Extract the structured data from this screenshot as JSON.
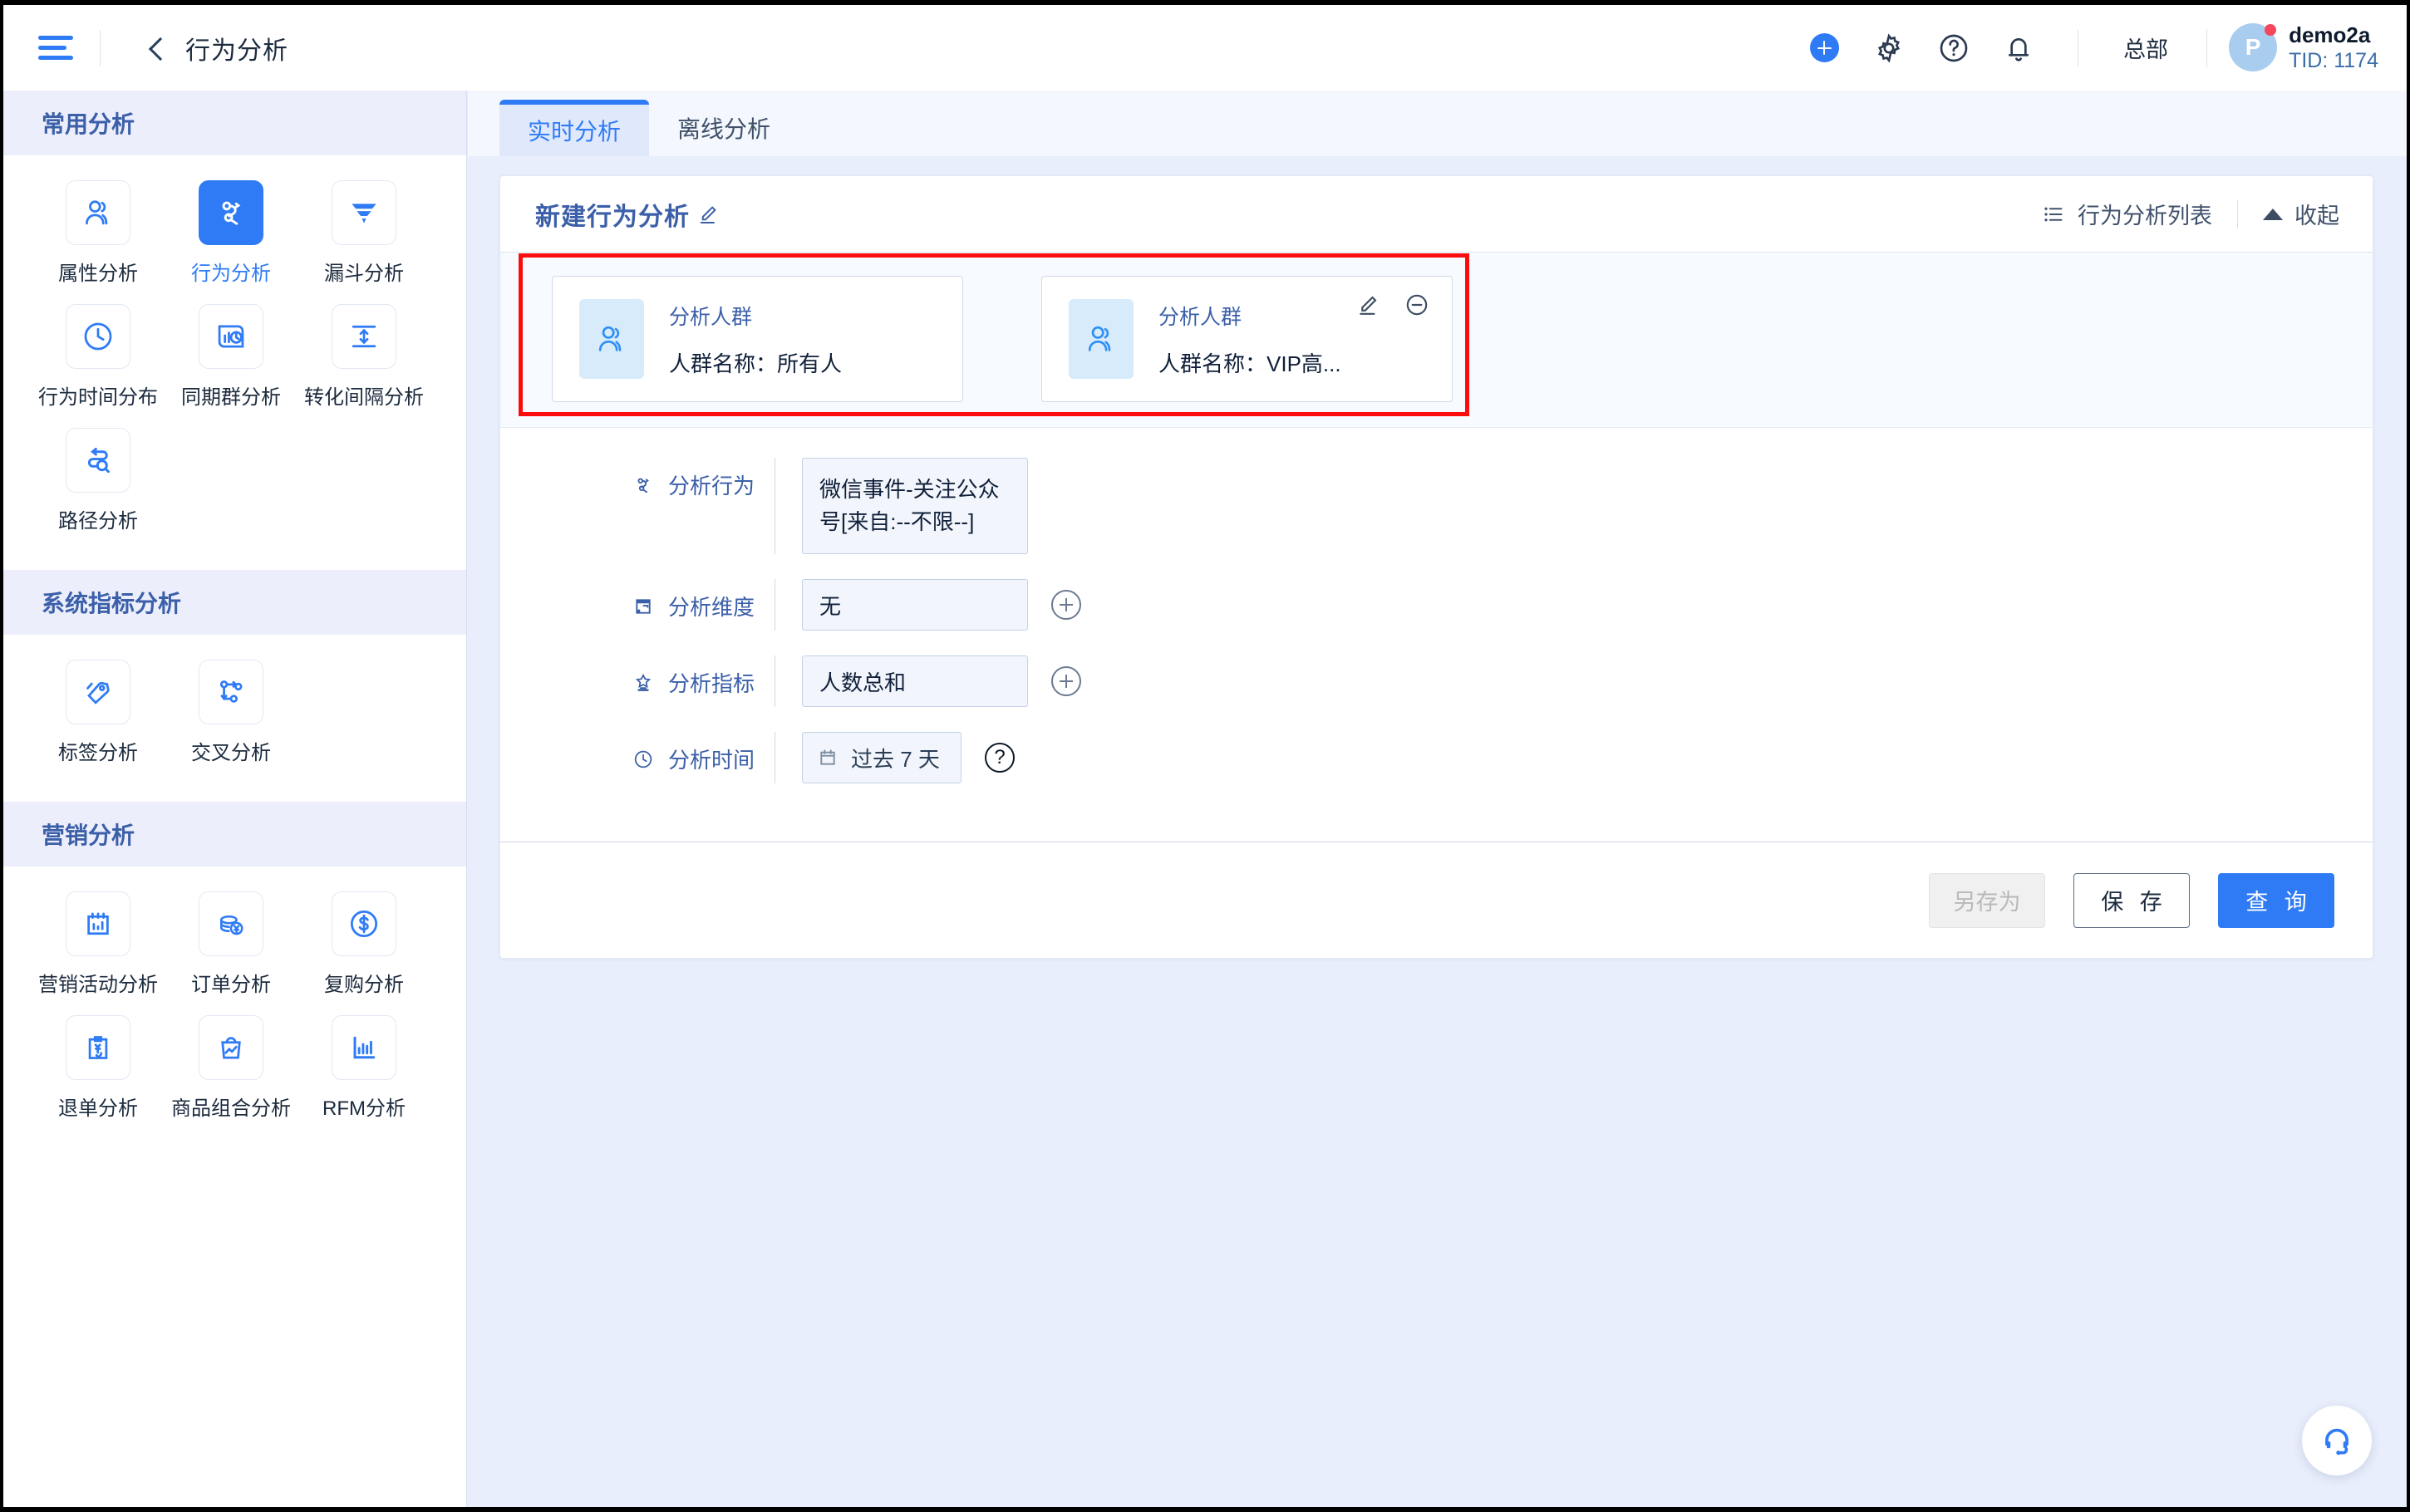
{
  "header": {
    "menu_icon": "hamburger-icon",
    "back_icon": "chevron-left-icon",
    "title": "行为分析",
    "actions": [
      {
        "name": "add-button",
        "icon": "plus-circle-icon"
      },
      {
        "name": "settings-button",
        "icon": "gear-icon"
      },
      {
        "name": "help-button",
        "icon": "question-circle-icon"
      },
      {
        "name": "notifications-button",
        "icon": "bell-icon"
      }
    ],
    "org": "总部",
    "user": {
      "initial": "P",
      "name": "demo2a",
      "tid": "TID: 1174",
      "has_badge": true
    }
  },
  "sidebar": {
    "sections": [
      {
        "title": "常用分析",
        "items": [
          {
            "label": "属性分析",
            "icon": "user-group-icon",
            "active": false
          },
          {
            "label": "行为分析",
            "icon": "behavior-flow-icon",
            "active": true
          },
          {
            "label": "漏斗分析",
            "icon": "funnel-icon",
            "active": false
          },
          {
            "label": "行为时间分布",
            "icon": "clock-icon",
            "active": false
          },
          {
            "label": "同期群分析",
            "icon": "cohort-chart-icon",
            "active": false
          },
          {
            "label": "转化间隔分析",
            "icon": "interval-arrows-icon",
            "active": false
          },
          {
            "label": "路径分析",
            "icon": "path-search-icon",
            "active": false
          }
        ]
      },
      {
        "title": "系统指标分析",
        "items": [
          {
            "label": "标签分析",
            "icon": "tag-icon",
            "active": false
          },
          {
            "label": "交叉分析",
            "icon": "cross-nodes-icon",
            "active": false
          }
        ]
      },
      {
        "title": "营销分析",
        "items": [
          {
            "label": "营销活动分析",
            "icon": "campaign-board-icon",
            "active": false
          },
          {
            "label": "订单分析",
            "icon": "coins-yuan-icon",
            "active": false
          },
          {
            "label": "复购分析",
            "icon": "dollar-circle-icon",
            "active": false
          },
          {
            "label": "退单分析",
            "icon": "refund-clipboard-icon",
            "active": false
          },
          {
            "label": "商品组合分析",
            "icon": "shopping-bag-trend-icon",
            "active": false
          },
          {
            "label": "RFM分析",
            "icon": "bar-chart-icon",
            "active": false
          }
        ]
      }
    ]
  },
  "main": {
    "tabs": [
      {
        "label": "实时分析",
        "active": true
      },
      {
        "label": "离线分析",
        "active": false
      }
    ],
    "card": {
      "title": "新建行为分析",
      "title_edit_icon": "pencil-icon",
      "list_link": {
        "label": "行为分析列表",
        "icon": "list-icon"
      },
      "collapse_link": {
        "label": "收起",
        "icon": "caret-up-icon"
      },
      "crowd_cards": [
        {
          "avatar_icon": "user-group-icon",
          "kicker": "分析人群",
          "name": "人群名称：所有人",
          "has_actions": false
        },
        {
          "avatar_icon": "user-group-icon",
          "kicker": "分析人群",
          "name": "人群名称：VIP高...",
          "has_actions": true,
          "edit_icon": "pencil-icon",
          "remove_icon": "minus-circle-icon"
        }
      ],
      "form": [
        {
          "icon": "behavior-flow-icon",
          "label": "分析行为",
          "value": "微信事件-关注公众号[来自:--不限--]",
          "kind": "behavior",
          "suffix": null
        },
        {
          "icon": "dimension-icon",
          "label": "分析维度",
          "value": "无",
          "kind": "std",
          "suffix": "plus"
        },
        {
          "icon": "metric-icon",
          "label": "分析指标",
          "value": "人数总和",
          "kind": "std",
          "suffix": "plus"
        },
        {
          "icon": "clock-icon",
          "label": "分析时间",
          "value": "过去 7 天",
          "kind": "date",
          "date_icon": "calendar-icon",
          "suffix": "help",
          "help_glyph": "?"
        }
      ],
      "footer_buttons": [
        {
          "label": "另存为",
          "style": "disabled",
          "name": "save-as-button"
        },
        {
          "label": "保 存",
          "style": "default",
          "name": "save-button"
        },
        {
          "label": "查 询",
          "style": "primary",
          "name": "query-button"
        }
      ]
    },
    "fab": {
      "icon": "headset-support-icon"
    },
    "highlight_color": "#fb0d0d"
  }
}
